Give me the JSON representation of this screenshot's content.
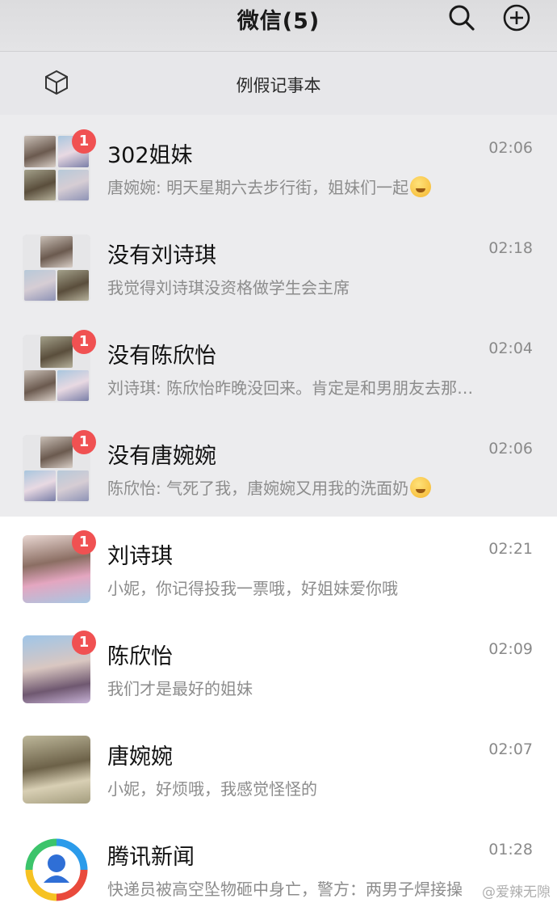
{
  "header": {
    "title": "微信(5)"
  },
  "folder": {
    "label": "例假记事本"
  },
  "chats": [
    {
      "name": "302姐妹",
      "time": "02:06",
      "preview": "唐婉婉: 明天星期六去步行街，姐妹们一起",
      "badge": "1",
      "pinned": true
    },
    {
      "name": "没有刘诗琪",
      "time": "02:18",
      "preview": "我觉得刘诗琪没资格做学生会主席",
      "badge": "",
      "pinned": true
    },
    {
      "name": "没有陈欣怡",
      "time": "02:04",
      "preview": "刘诗琪: 陈欣怡昨晚没回来。肯定是和男朋友去那…",
      "badge": "1",
      "pinned": true
    },
    {
      "name": "没有唐婉婉",
      "time": "02:06",
      "preview": "陈欣怡: 气死了我，唐婉婉又用我的洗面奶",
      "badge": "1",
      "pinned": true
    },
    {
      "name": "刘诗琪",
      "time": "02:21",
      "preview": "小妮，你记得投我一票哦，好姐妹爱你哦",
      "badge": "1",
      "pinned": false
    },
    {
      "name": "陈欣怡",
      "time": "02:09",
      "preview": "我们才是最好的姐妹",
      "badge": "1",
      "pinned": false
    },
    {
      "name": "唐婉婉",
      "time": "02:07",
      "preview": "小妮，好烦哦，我感觉怪怪的",
      "badge": "",
      "pinned": false
    },
    {
      "name": "腾讯新闻",
      "time": "01:28",
      "preview": "快递员被高空坠物砸中身亡，警方：两男子焊接操",
      "badge": "",
      "pinned": false
    }
  ],
  "watermark": "@爱辣无隙",
  "colors": {
    "badge": "#f05152",
    "pinned_background": "#ececee",
    "header_background": "#dcdcde"
  }
}
